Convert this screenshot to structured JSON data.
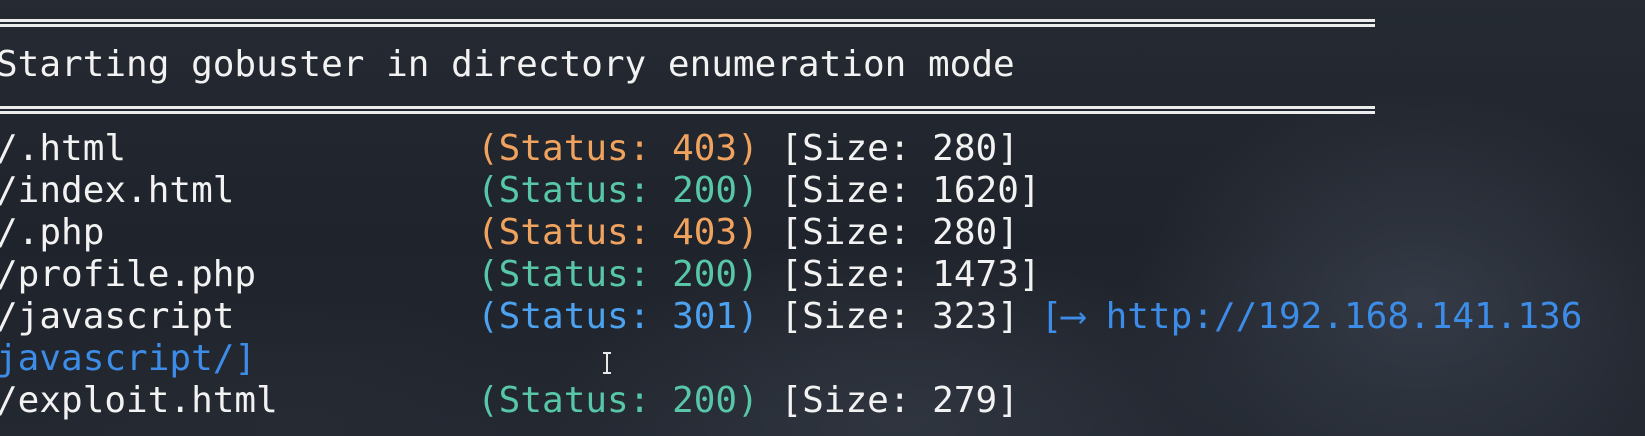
{
  "header": {
    "title": "Starting gobuster in directory enumeration mode"
  },
  "results": [
    {
      "path": "/.html",
      "status_label": "(Status: 403)",
      "status_code": 403,
      "size_label": "[Size: 280]",
      "redirect": ""
    },
    {
      "path": "/index.html",
      "status_label": "(Status: 200)",
      "status_code": 200,
      "size_label": "[Size: 1620]",
      "redirect": ""
    },
    {
      "path": "/.php",
      "status_label": "(Status: 403)",
      "status_code": 403,
      "size_label": "[Size: 280]",
      "redirect": ""
    },
    {
      "path": "/profile.php",
      "status_label": "(Status: 200)",
      "status_code": 200,
      "size_label": "[Size: 1473]",
      "redirect": ""
    },
    {
      "path": "/javascript",
      "status_label": "(Status: 301)",
      "status_code": 301,
      "size_label": "[Size: 323]",
      "redirect": "[⟶ http://192.168.141.136"
    },
    {
      "path": "/exploit.html",
      "status_label": "(Status: 200)",
      "status_code": 200,
      "size_label": "[Size: 279]",
      "redirect": ""
    }
  ],
  "redirect_wrap": "javascript/]",
  "colors": {
    "status_403": "#f0a35e",
    "status_200": "#57c7a8",
    "status_301": "#4da2f0",
    "redirect": "#3c8ce8",
    "text": "#f2f2f2",
    "background": "#1e2229"
  },
  "cursor": {
    "icon": "text-cursor-icon"
  }
}
